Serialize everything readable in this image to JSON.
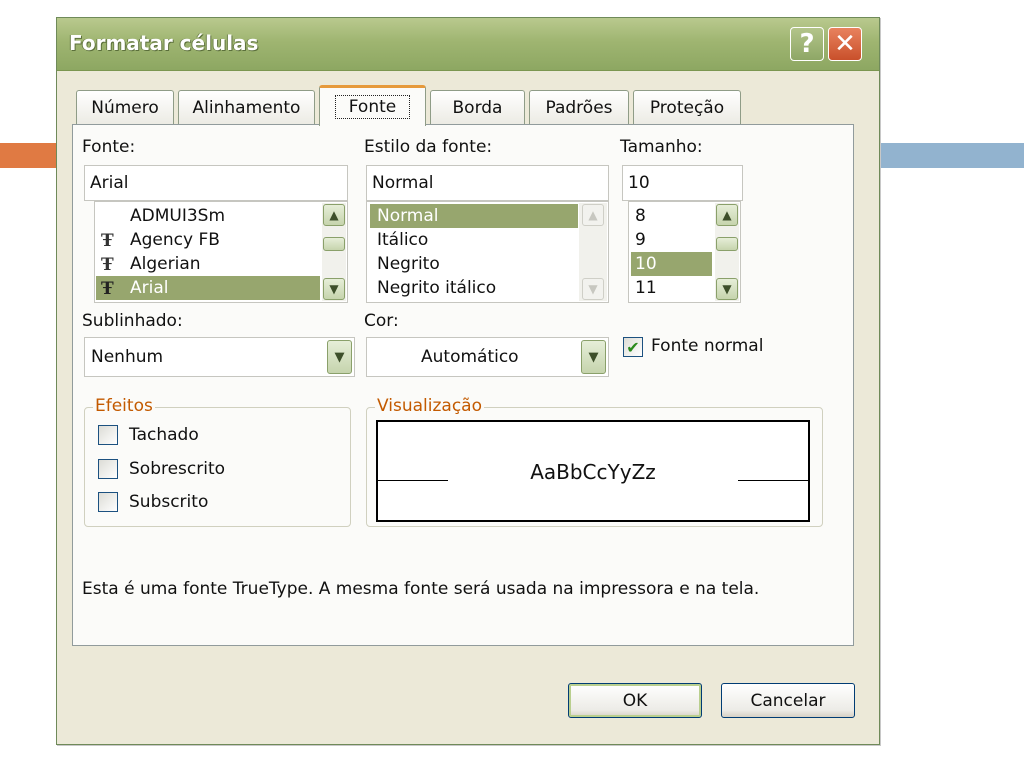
{
  "dialog": {
    "title": "Formatar células",
    "help_glyph": "?",
    "close_glyph": "✕"
  },
  "tabs": [
    {
      "label": "Número"
    },
    {
      "label": "Alinhamento"
    },
    {
      "label": "Fonte",
      "active": true
    },
    {
      "label": "Borda"
    },
    {
      "label": "Padrões"
    },
    {
      "label": "Proteção"
    }
  ],
  "font": {
    "label": "Fonte:",
    "value": "Arial",
    "items": [
      "ADMUI3Sm",
      "Agency FB",
      "Algerian",
      "Arial"
    ],
    "selected": "Arial"
  },
  "style": {
    "label": "Estilo da fonte:",
    "value": "Normal",
    "items": [
      "Normal",
      "Itálico",
      "Negrito",
      "Negrito itálico"
    ],
    "selected": "Normal"
  },
  "size": {
    "label": "Tamanho:",
    "value": "10",
    "items": [
      "8",
      "9",
      "10",
      "11"
    ],
    "selected": "10"
  },
  "underline": {
    "label": "Sublinhado:",
    "value": "Nenhum"
  },
  "color": {
    "label": "Cor:",
    "value": "Automático"
  },
  "normal_font": {
    "label": "Fonte normal",
    "checked": true
  },
  "effects": {
    "legend": "Efeitos",
    "strikethrough": "Tachado",
    "superscript": "Sobrescrito",
    "subscript": "Subscrito"
  },
  "preview": {
    "legend": "Visualização",
    "sample": "AaBbCcYyZz"
  },
  "info_text": "Esta é uma fonte TrueType. A mesma fonte será usada na impressora e na tela.",
  "buttons": {
    "ok": "OK",
    "cancel": "Cancelar"
  },
  "colors": {
    "title_bar": "#9fb571",
    "tab_highlight": "#e69a3c",
    "selection": "#97a66e",
    "effects_legend": "#c35a00"
  }
}
